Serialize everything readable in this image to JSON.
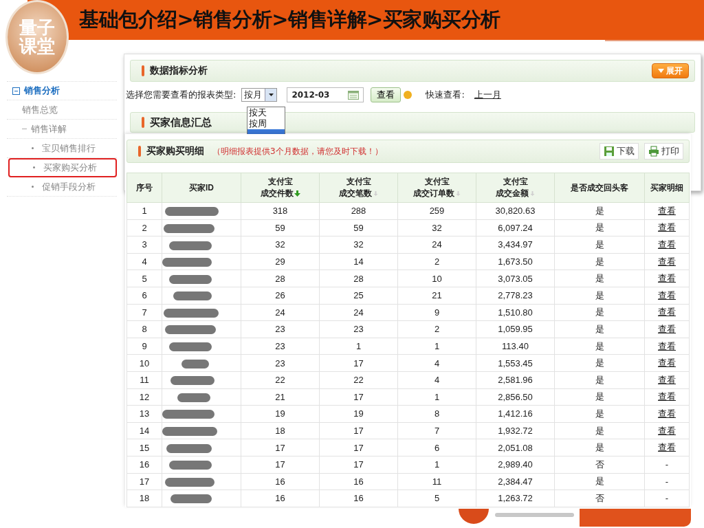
{
  "slide": {
    "title": "基础包介绍>销售分析>销售详解>买家购买分析",
    "logo_text": [
      "量子",
      "课堂"
    ]
  },
  "sidebar": {
    "items": [
      {
        "label": "销售分析",
        "expanded": true,
        "selected": false,
        "children": [
          {
            "label": "销售总览",
            "selected": false
          },
          {
            "label": "销售详解",
            "expanded": true,
            "selected": false,
            "children": [
              {
                "label": "宝贝销售排行",
                "selected": false
              },
              {
                "label": "买家购买分析",
                "selected": true
              },
              {
                "label": "促销手段分析",
                "selected": false
              }
            ]
          }
        ]
      }
    ]
  },
  "metrics_panel": {
    "title": "数据指标分析",
    "expand_button": "展开",
    "report_type_label": "选择您需要查看的报表类型:",
    "report_type": "按月",
    "dropdown_options": [
      {
        "label": "按天",
        "selected": false
      },
      {
        "label": "按周",
        "selected": false
      },
      {
        "selected": true
      }
    ],
    "date": "2012-03",
    "view_button": "查看",
    "quick_view_label": "快速查看:",
    "quick_view_link": "上一月",
    "summary_title": "买家信息汇总"
  },
  "detail_panel": {
    "title": "买家购买明细",
    "note": "（明细报表提供3个月数据，请您及时下载！）",
    "buttons": [
      {
        "kind": "download",
        "label": "下载"
      },
      {
        "kind": "print",
        "label": "打印"
      }
    ],
    "table": {
      "columns": [
        {
          "label": [
            "序号"
          ],
          "sortable": false
        },
        {
          "label": [
            "买家ID"
          ],
          "sortable": false
        },
        {
          "label": [
            "支付宝",
            "成交件数"
          ],
          "sortable": true,
          "sorted": true
        },
        {
          "label": [
            "支付宝",
            "成交笔数"
          ],
          "sortable": true,
          "sorted": false
        },
        {
          "label": [
            "支付宝",
            "成交订单数"
          ],
          "sortable": true,
          "sorted": false
        },
        {
          "label": [
            "支付宝",
            "成交金额"
          ],
          "sortable": true,
          "sorted": false
        },
        {
          "label": [
            "是否成交回头客"
          ],
          "sortable": false
        },
        {
          "label": [
            "买家明细"
          ],
          "sortable": false
        }
      ],
      "rows": [
        {
          "no": "1",
          "items": "318",
          "payments": "288",
          "orders": "259",
          "amount": "30,820.63",
          "returning": "是",
          "detail": "查看",
          "detail_link": true
        },
        {
          "no": "2",
          "items": "59",
          "payments": "59",
          "orders": "32",
          "amount": "6,097.24",
          "returning": "是",
          "detail": "查看",
          "detail_link": true
        },
        {
          "no": "3",
          "items": "32",
          "payments": "32",
          "orders": "24",
          "amount": "3,434.97",
          "returning": "是",
          "detail": "查看",
          "detail_link": true
        },
        {
          "no": "4",
          "items": "29",
          "payments": "14",
          "orders": "2",
          "amount": "1,673.50",
          "returning": "是",
          "detail": "查看",
          "detail_link": true
        },
        {
          "no": "5",
          "items": "28",
          "payments": "28",
          "orders": "10",
          "amount": "3,073.05",
          "returning": "是",
          "detail": "查看",
          "detail_link": true
        },
        {
          "no": "6",
          "items": "26",
          "payments": "25",
          "orders": "21",
          "amount": "2,778.23",
          "returning": "是",
          "detail": "查看",
          "detail_link": true
        },
        {
          "no": "7",
          "items": "24",
          "payments": "24",
          "orders": "9",
          "amount": "1,510.80",
          "returning": "是",
          "detail": "查看",
          "detail_link": true
        },
        {
          "no": "8",
          "items": "23",
          "payments": "23",
          "orders": "2",
          "amount": "1,059.95",
          "returning": "是",
          "detail": "查看",
          "detail_link": true
        },
        {
          "no": "9",
          "items": "23",
          "payments": "1",
          "orders": "1",
          "amount": "113.40",
          "returning": "是",
          "detail": "查看",
          "detail_link": true
        },
        {
          "no": "10",
          "items": "23",
          "payments": "17",
          "orders": "4",
          "amount": "1,553.45",
          "returning": "是",
          "detail": "查看",
          "detail_link": true
        },
        {
          "no": "11",
          "items": "22",
          "payments": "22",
          "orders": "4",
          "amount": "2,581.96",
          "returning": "是",
          "detail": "查看",
          "detail_link": true
        },
        {
          "no": "12",
          "items": "21",
          "payments": "17",
          "orders": "1",
          "amount": "2,856.50",
          "returning": "是",
          "detail": "查看",
          "detail_link": true
        },
        {
          "no": "13",
          "items": "19",
          "payments": "19",
          "orders": "8",
          "amount": "1,412.16",
          "returning": "是",
          "detail": "查看",
          "detail_link": true
        },
        {
          "no": "14",
          "items": "18",
          "payments": "17",
          "orders": "7",
          "amount": "1,932.72",
          "returning": "是",
          "detail": "查看",
          "detail_link": true
        },
        {
          "no": "15",
          "items": "17",
          "payments": "17",
          "orders": "6",
          "amount": "2,051.08",
          "returning": "是",
          "detail": "查看",
          "detail_link": true
        },
        {
          "no": "16",
          "items": "17",
          "payments": "17",
          "orders": "1",
          "amount": "2,989.40",
          "returning": "否",
          "detail": "-",
          "detail_link": false
        },
        {
          "no": "17",
          "items": "16",
          "payments": "16",
          "orders": "11",
          "amount": "2,384.47",
          "returning": "是",
          "detail": "-",
          "detail_link": false
        },
        {
          "no": "18",
          "items": "16",
          "payments": "16",
          "orders": "5",
          "amount": "1,263.72",
          "returning": "否",
          "detail": "-",
          "detail_link": false
        }
      ]
    }
  }
}
